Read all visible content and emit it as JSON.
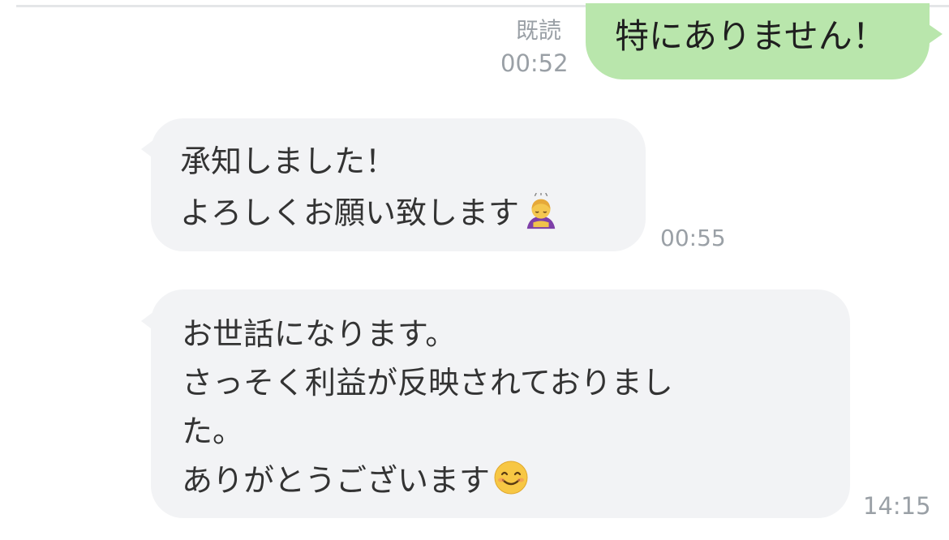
{
  "chat": {
    "messages": [
      {
        "direction": "outgoing",
        "lines": [
          "特にありません！"
        ],
        "read_label": "既読",
        "time": "00:52",
        "bubble_color": "#b9e6ac"
      },
      {
        "direction": "incoming",
        "lines": [
          "承知しました！",
          "よろしくお願い致します"
        ],
        "trailing_emoji": "person-bowing-emoji",
        "time": "00:55",
        "bubble_color": "#f2f3f5"
      },
      {
        "direction": "incoming",
        "lines": [
          "お世話になります。",
          "さっそく利益が反映されておりまし",
          "た。",
          "ありがとうございます"
        ],
        "trailing_emoji": "smiling-face-emoji",
        "time": "14:15",
        "bubble_color": "#f2f3f5"
      }
    ]
  }
}
